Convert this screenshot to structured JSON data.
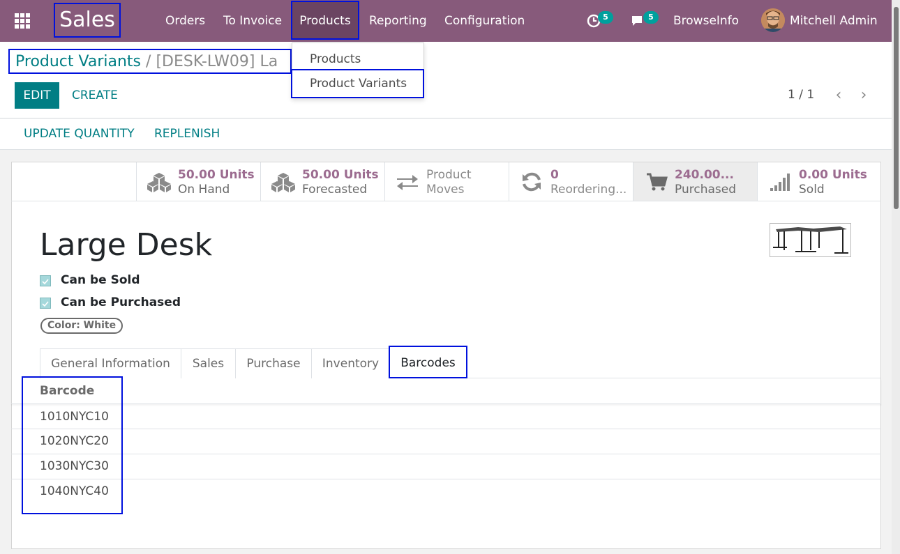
{
  "navbar": {
    "app_name": "Sales",
    "menu": [
      "Orders",
      "To Invoice",
      "Products",
      "Reporting",
      "Configuration"
    ],
    "activity_count": "5",
    "message_count": "5",
    "company": "BrowseInfo",
    "user": "Mitchell Admin"
  },
  "dropdown": {
    "items": [
      "Products",
      "Product Variants"
    ]
  },
  "breadcrumb": {
    "parent": "Product Variants",
    "separator": "/",
    "current": "[DESK-LW09] La"
  },
  "actions": {
    "edit": "EDIT",
    "create": "CREATE",
    "pager": "1 / 1"
  },
  "statusbar": {
    "update_quantity": "UPDATE QUANTITY",
    "replenish": "REPLENISH"
  },
  "smart_buttons": [
    {
      "value": "50.00 Units",
      "label": "On Hand",
      "icon": "cubes-icon"
    },
    {
      "value": "50.00 Units",
      "label": "Forecasted",
      "icon": "cubes-icon"
    },
    {
      "value": "Product",
      "label": "Moves",
      "icon": "exchange-icon"
    },
    {
      "value": "0",
      "label": "Reordering...",
      "icon": "refresh-icon"
    },
    {
      "value": "240.00...",
      "label": "Purchased",
      "icon": "cart-icon"
    },
    {
      "value": "0.00 Units",
      "label": "Sold",
      "icon": "signal-icon"
    }
  ],
  "product": {
    "name": "Large Desk",
    "can_be_sold": "Can be Sold",
    "can_be_purchased": "Can be Purchased",
    "attribute_tag": "Color: White"
  },
  "tabs": [
    "General Information",
    "Sales",
    "Purchase",
    "Inventory",
    "Barcodes"
  ],
  "barcodes": {
    "header": "Barcode",
    "rows": [
      "1010NYC10",
      "1020NYC20",
      "1030NYC30",
      "1040NYC40"
    ]
  },
  "colors": {
    "navbar": "#875a7b",
    "accent": "#017e84",
    "highlight_box": "#0011dd"
  }
}
